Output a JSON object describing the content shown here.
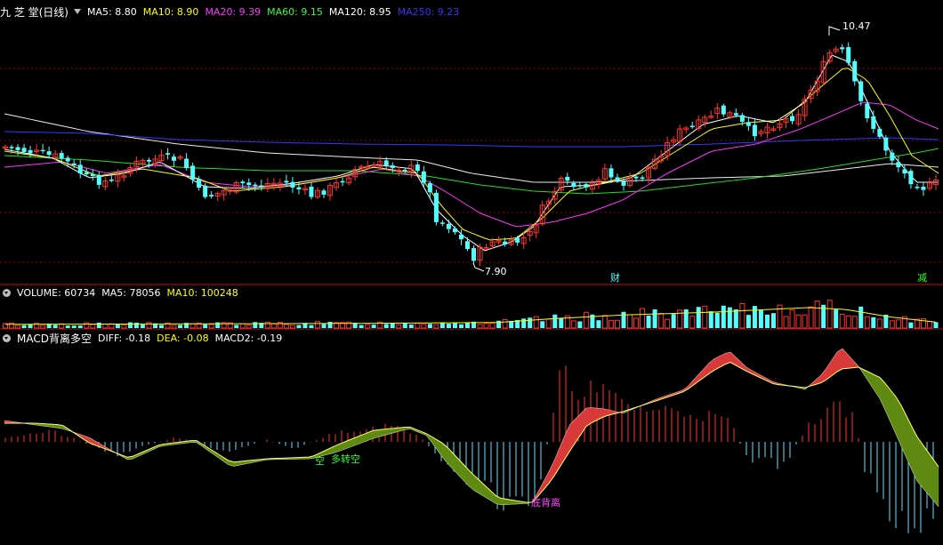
{
  "price_panel": {
    "title": "九 芝 堂(日线)",
    "indicators": [
      {
        "label": "MA5: 8.80",
        "color": "#ffffff"
      },
      {
        "label": "MA10: 8.90",
        "color": "#ffff00"
      },
      {
        "label": "MA20: 9.39",
        "color": "#ff33ff"
      },
      {
        "label": "MA60: 9.15",
        "color": "#33ff33"
      },
      {
        "label": "MA120: 8.95",
        "color": "#ffffff"
      },
      {
        "label": "MA250: 9.23",
        "color": "#3333ff"
      }
    ],
    "high_label": "10.47",
    "low_label": "7.90",
    "event_1": "财",
    "event_2": "减"
  },
  "volume_panel": {
    "items": [
      {
        "label": "VOLUME: 60734",
        "color": "#ffffff"
      },
      {
        "label": "MA5: 78056",
        "color": "#ffffff"
      },
      {
        "label": "MA10: 100248",
        "color": "#ffff00"
      }
    ]
  },
  "macd_panel": {
    "title": "MACD背离多空",
    "items": [
      {
        "label": "DIFF: -0.18",
        "color": "#ffffff"
      },
      {
        "label": "DEA: -0.08",
        "color": "#ffff00"
      },
      {
        "label": "MACD2: -0.19",
        "color": "#ffffff"
      }
    ],
    "annotation_1": "空",
    "annotation_2": "多转空",
    "annotation_3": "底背离"
  },
  "colors": {
    "up": "#ff3333",
    "down": "#54ffff",
    "grid": "#8b0000",
    "macd_fill_up": "#d83a3a",
    "macd_fill_down": "#5e8a12"
  }
}
